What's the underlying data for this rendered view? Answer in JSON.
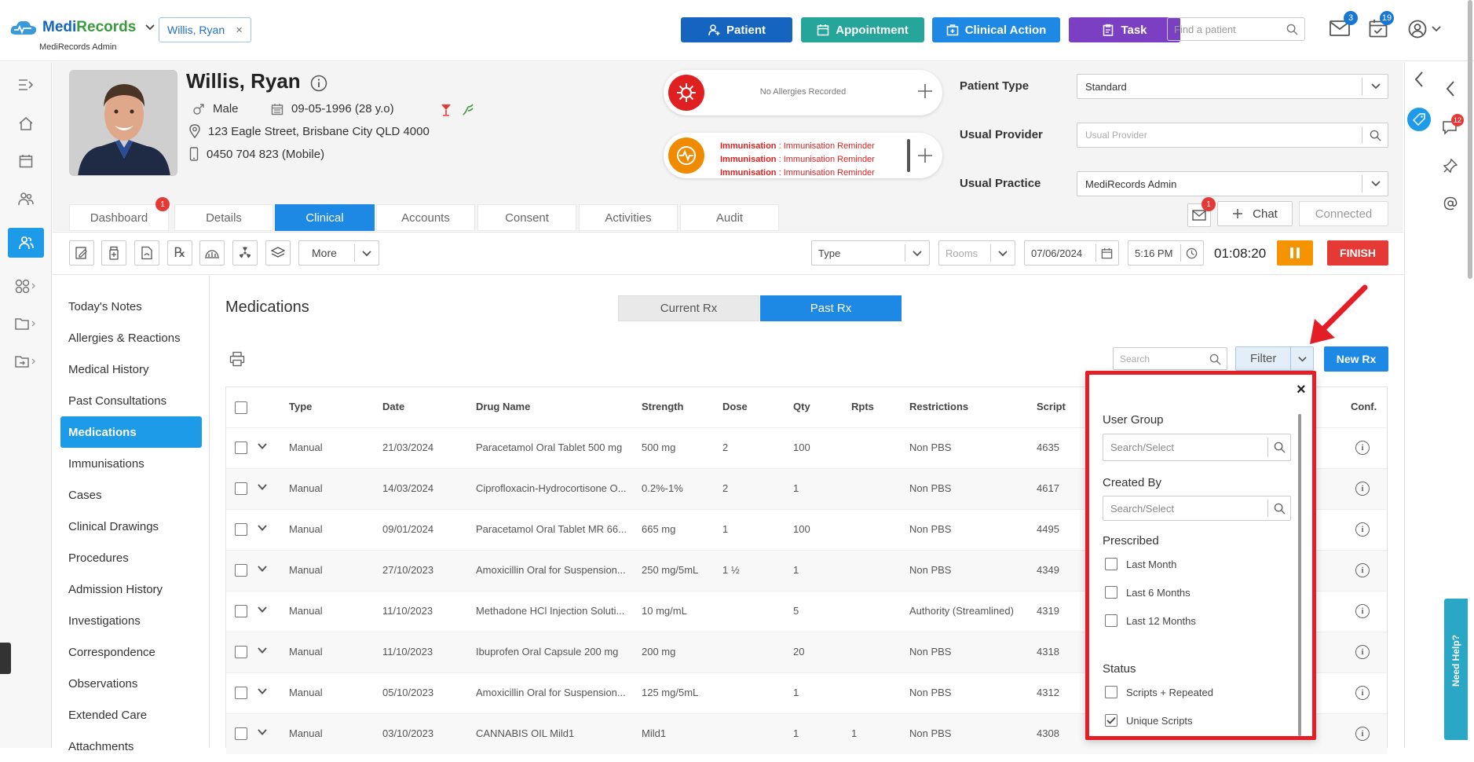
{
  "brand": {
    "name_part1": "Medi",
    "name_part2": "Records",
    "subtitle": "MediRecords Admin"
  },
  "open_patient_tab": "Willis, Ryan",
  "top_actions": {
    "patient": "Patient",
    "appointment": "Appointment",
    "clinical_action": "Clinical Action",
    "task": "Task"
  },
  "top_search_placeholder": "Find a patient",
  "mail_badge": "3",
  "calendar_badge": "19",
  "patient": {
    "name": "Willis, Ryan",
    "gender": "Male",
    "dob": "09-05-1996 (28 y.o)",
    "address": "123 Eagle Street, Brisbane City QLD 4000",
    "phone": "0450 704 823 (Mobile)"
  },
  "allergy_text": "No Allergies Recorded",
  "immunisation_lines": [
    {
      "label": "Immunisation",
      "sep": " : ",
      "value": "Immunisation Reminder"
    },
    {
      "label": "Immunisation",
      "sep": " : ",
      "value": "Immunisation Reminder"
    },
    {
      "label": "Immunisation",
      "sep": " : ",
      "value": "Immunisation Reminder"
    }
  ],
  "fields": {
    "patient_type_label": "Patient Type",
    "patient_type_value": "Standard",
    "usual_provider_label": "Usual Provider",
    "usual_provider_placeholder": "Usual Provider",
    "usual_practice_label": "Usual Practice",
    "usual_practice_value": "MediRecords Admin"
  },
  "chat": {
    "badge": "1",
    "label": "Chat",
    "status": "Connected"
  },
  "tabs": [
    "Dashboard",
    "Details",
    "Clinical",
    "Accounts",
    "Consent",
    "Activities",
    "Audit"
  ],
  "dashboard_badge": "1",
  "toolbar": {
    "more": "More",
    "type": "Type",
    "rooms": "Rooms",
    "date": "07/06/2024",
    "time": "5:16 PM",
    "timer": "01:08:20",
    "finish": "FINISH"
  },
  "left_nav": [
    "Today's Notes",
    "Allergies & Reactions",
    "Medical History",
    "Past Consultations",
    "Medications",
    "Immunisations",
    "Cases",
    "Clinical Drawings",
    "Procedures",
    "Admission History",
    "Investigations",
    "Correspondence",
    "Observations",
    "Extended Care",
    "Attachments"
  ],
  "main": {
    "title": "Medications",
    "seg_current": "Current Rx",
    "seg_past": "Past Rx",
    "search_placeholder": "Search",
    "filter_label": "Filter",
    "new_rx": "New Rx"
  },
  "table": {
    "headers": [
      "Type",
      "Date",
      "Drug Name",
      "Strength",
      "Dose",
      "Qty",
      "Rpts",
      "Restrictions",
      "Script",
      "Conf."
    ],
    "rows": [
      [
        "Manual",
        "21/03/2024",
        "Paracetamol Oral Tablet 500 mg",
        "500 mg",
        "2",
        "100",
        "",
        "Non PBS",
        "4635"
      ],
      [
        "Manual",
        "14/03/2024",
        "Ciprofloxacin-Hydrocortisone O...",
        "0.2%-1%",
        "2",
        "1",
        "",
        "Non PBS",
        "4617"
      ],
      [
        "Manual",
        "09/01/2024",
        "Paracetamol Oral Tablet MR 66...",
        "665 mg",
        "1",
        "100",
        "",
        "Non PBS",
        "4495"
      ],
      [
        "Manual",
        "27/10/2023",
        "Amoxicillin Oral for Suspension...",
        "250 mg/5mL",
        "1 ½",
        "1",
        "",
        "Non PBS",
        "4349"
      ],
      [
        "Manual",
        "11/10/2023",
        "Methadone HCl Injection Soluti...",
        "10 mg/mL",
        "",
        "5",
        "",
        "Authority (Streamlined)",
        "4319"
      ],
      [
        "Manual",
        "11/10/2023",
        "Ibuprofen Oral Capsule 200 mg",
        "200 mg",
        "",
        "20",
        "",
        "Non PBS",
        "4318"
      ],
      [
        "Manual",
        "05/10/2023",
        "Amoxicillin Oral for Suspension...",
        "125 mg/5mL",
        "",
        "1",
        "",
        "Non PBS",
        "4312"
      ],
      [
        "Manual",
        "03/10/2023",
        "CANNABIS OIL Mild1",
        "Mild1",
        "",
        "1",
        "1",
        "Non PBS",
        "4308"
      ]
    ]
  },
  "filter_panel": {
    "user_group_label": "User Group",
    "user_group_placeholder": "Search/Select",
    "created_by_label": "Created By",
    "created_by_placeholder": "Search/Select",
    "prescribed_label": "Prescribed",
    "prescribed_options": [
      "Last Month",
      "Last 6 Months",
      "Last 12 Months"
    ],
    "status_label": "Status",
    "status_options": [
      "Scripts + Repeated",
      "Unique Scripts"
    ],
    "close": "×"
  },
  "right_strip": {
    "notif_badge": "12",
    "help": "Need Help?"
  },
  "colors": {
    "primary": "#1e88e5",
    "patient_btn": "#1565c0",
    "appointment_btn": "#26a69a",
    "task_btn": "#7b3fc4",
    "timer_pause": "#f59300",
    "finish": "#e53935",
    "annotation": "#e41e26"
  }
}
